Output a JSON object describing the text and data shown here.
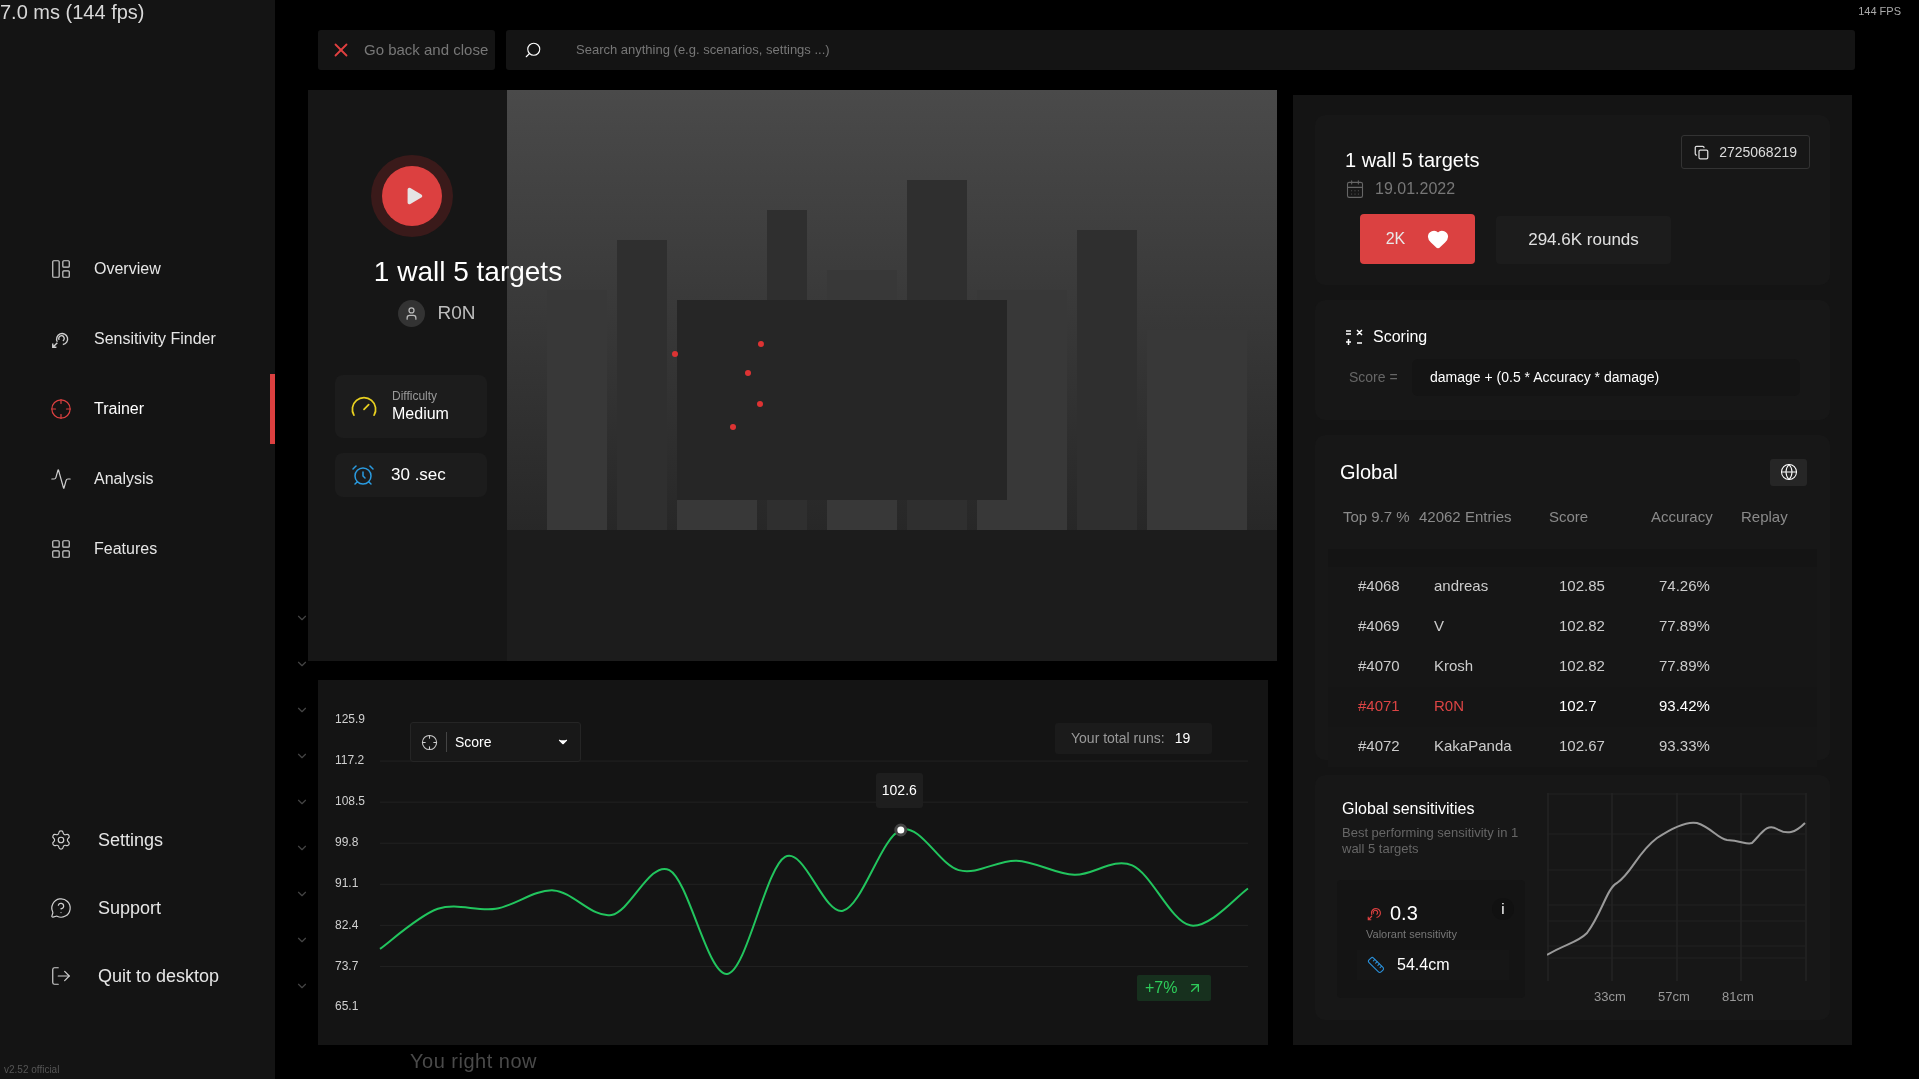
{
  "fps_overlay": "7.0 ms (144 fps)",
  "fps_badge": "144 FPS",
  "version": "v2.52 official",
  "sidebar": {
    "items": [
      {
        "label": "Overview",
        "selected": false
      },
      {
        "label": "Sensitivity Finder",
        "selected": false
      },
      {
        "label": "Trainer",
        "selected": true
      },
      {
        "label": "Analysis",
        "selected": false
      },
      {
        "label": "Features",
        "selected": false
      }
    ],
    "bottom_items": [
      {
        "label": "Settings"
      },
      {
        "label": "Support"
      },
      {
        "label": "Quit to desktop"
      }
    ]
  },
  "top_bar": {
    "back_button": "Go back and close",
    "search": {
      "placeholder": "Search anything (e.g. scenarios, settings ...)"
    }
  },
  "hero": {
    "title": "1 wall 5 targets",
    "author": "R0N",
    "difficulty_label": "Difficulty",
    "difficulty": "Medium",
    "duration": "30 .sec"
  },
  "runs_chart": {
    "total_runs_label": "Your total runs:",
    "total_runs": "19",
    "change": "+7%",
    "chart_data": {
      "type": "line",
      "grid": true,
      "yticks": [
        125.9,
        117.2,
        108.5,
        99.8,
        91.1,
        82.4,
        73.7,
        65.1
      ],
      "ylim": [
        65.1,
        125.9
      ],
      "series": [
        {
          "name": "Score",
          "color": "#22c55e",
          "values": [
            77.4,
            85.9,
            85.9,
            89.8,
            84.6,
            94.1,
            72.1,
            96.9,
            85.5,
            102.6,
            94.1,
            96.1,
            93.1,
            95.1,
            82.4,
            90.2
          ]
        }
      ]
    },
    "tooltip": "102.6"
  },
  "footer_heading": "You right now",
  "scenario_card": {
    "title": "1 wall 5 targets",
    "date": "19.01.2022",
    "id": "2725068219",
    "likes": "2K",
    "liked": true,
    "rounds": "294.6K rounds"
  },
  "scoring": {
    "title": "Scoring",
    "label": "Score =",
    "formula": "damage + (0.5 * Accuracy * damage)"
  },
  "leaderboard": {
    "title": "Global",
    "columns": [
      "Top 9.7 %",
      "42062 Entries",
      "Score",
      "Accuracy",
      "Replay"
    ],
    "rows": [
      {
        "rank": "#4068",
        "name": "andreas",
        "score": "102.85",
        "accuracy": "74.26%",
        "selected": false
      },
      {
        "rank": "#4069",
        "name": "V",
        "score": "102.82",
        "accuracy": "77.89%",
        "selected": false
      },
      {
        "rank": "#4070",
        "name": "Krosh",
        "score": "102.82",
        "accuracy": "77.89%",
        "selected": false
      },
      {
        "rank": "#4071",
        "name": "R0N",
        "score": "102.7",
        "accuracy": "93.42%",
        "selected": true
      },
      {
        "rank": "#4072",
        "name": "KakaPanda",
        "score": "102.67",
        "accuracy": "93.33%",
        "selected": false
      }
    ]
  },
  "sensitivities": {
    "title": "Global sensitivities",
    "subtitle": "Best performing sensitivity in 1 wall 5 targets",
    "value": "0.3",
    "value_label": "Valorant sensitivity",
    "info": "i",
    "cm": "54.4cm",
    "x_labels": [
      "33cm",
      "57cm",
      "81cm"
    ]
  }
}
